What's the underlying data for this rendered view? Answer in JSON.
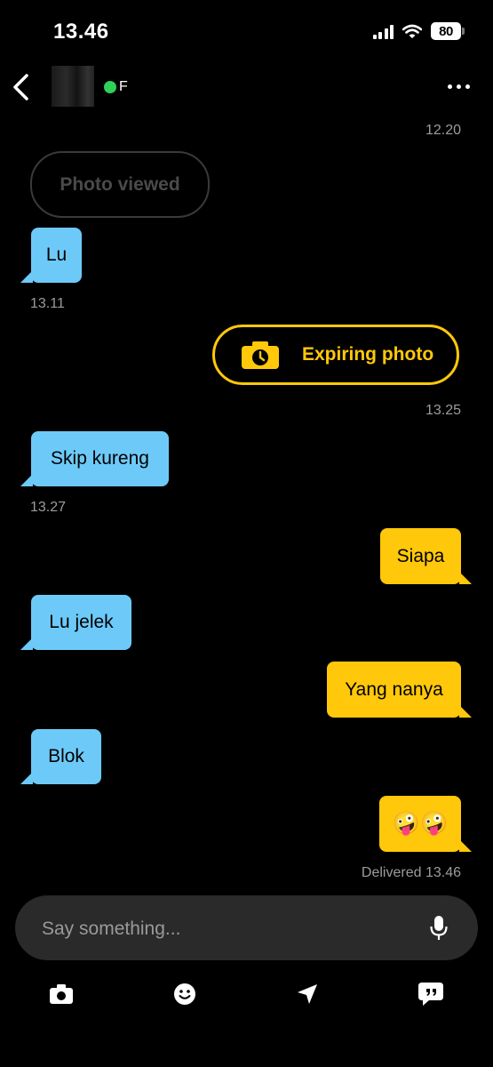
{
  "status_bar": {
    "time": "13.46",
    "battery": "80"
  },
  "header": {
    "contact_name": "F"
  },
  "messages": [
    {
      "kind": "timestamp",
      "text": "12.20"
    },
    {
      "kind": "photo_viewed",
      "text": "Photo viewed"
    },
    {
      "kind": "incoming",
      "text": "Lu",
      "time": "13.11"
    },
    {
      "kind": "expiring_photo",
      "text": "Expiring photo",
      "time": "13.25"
    },
    {
      "kind": "incoming",
      "text": "Skip kureng",
      "time": "13.27"
    },
    {
      "kind": "outgoing",
      "text": "Siapa"
    },
    {
      "kind": "incoming",
      "text": "Lu jelek"
    },
    {
      "kind": "outgoing",
      "text": "Yang nanya"
    },
    {
      "kind": "incoming",
      "text": "Blok"
    },
    {
      "kind": "outgoing",
      "text": "🤪🤪",
      "status": "Delivered",
      "time": "13.46"
    }
  ],
  "composer": {
    "placeholder": "Say something..."
  },
  "toolbar": [
    "camera-icon",
    "smiley-icon",
    "location-icon",
    "quick-replies-icon"
  ],
  "colors": {
    "incoming_bubble": "#6dcaf8",
    "outgoing_bubble": "#ffc80a",
    "online": "#2fd158",
    "background": "#000000"
  }
}
